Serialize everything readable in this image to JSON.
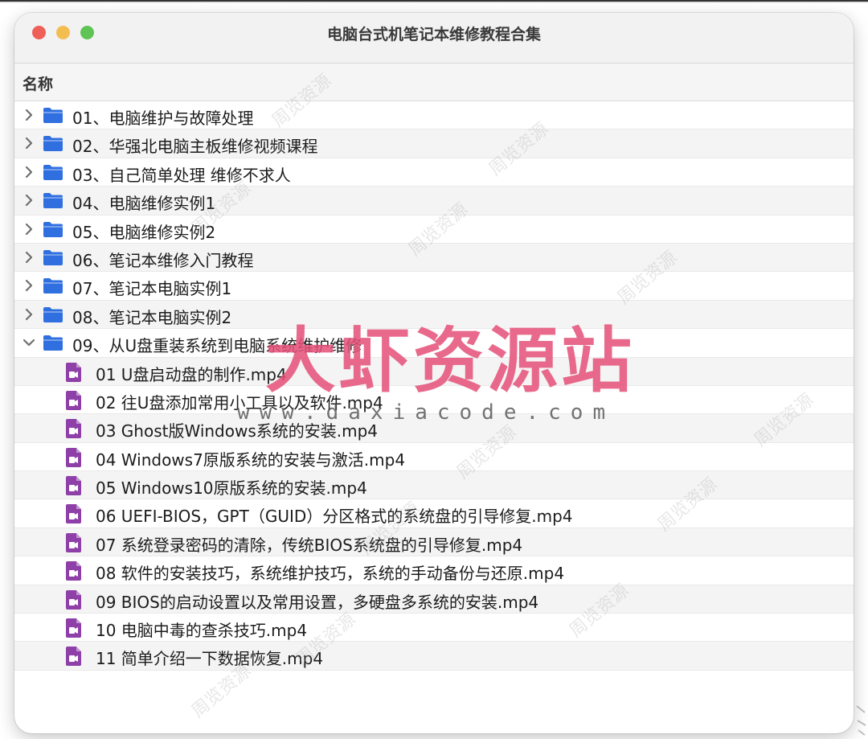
{
  "window": {
    "title": "电脑台式机笔记本维修教程合集"
  },
  "column_header": {
    "name": "名称"
  },
  "folders": [
    {
      "label": "01、电脑维护与故障处理",
      "expanded": false
    },
    {
      "label": "02、华强北电脑主板维修视频课程",
      "expanded": false
    },
    {
      "label": "03、自己简单处理 维修不求人",
      "expanded": false
    },
    {
      "label": "04、电脑维修实例1",
      "expanded": false
    },
    {
      "label": "05、电脑维修实例2",
      "expanded": false
    },
    {
      "label": "06、笔记本维修入门教程",
      "expanded": false
    },
    {
      "label": "07、笔记本电脑实例1",
      "expanded": false
    },
    {
      "label": "08、笔记本电脑实例2",
      "expanded": false
    },
    {
      "label": "09、从U盘重装系统到电脑系统维护维修",
      "expanded": true
    }
  ],
  "files": [
    "01 U盘启动盘的制作.mp4",
    "02 往U盘添加常用小工具以及软件.mp4",
    "03 Ghost版Windows系统的安装.mp4",
    "04 Windows7原版系统的安装与激活.mp4",
    "05 Windows10原版系统的安装.mp4",
    "06 UEFI-BIOS，GPT（GUID）分区格式的系统盘的引导修复.mp4",
    "07 系统登录密码的清除，传统BIOS系统盘的引导修复.mp4",
    "08 软件的安装技巧，系统维护技巧，系统的手动备份与还原.mp4",
    "09 BIOS的启动设置以及常用设置，多硬盘多系统的安装.mp4",
    "10 电脑中毒的查杀技巧.mp4",
    "11 简单介绍一下数据恢复.mp4"
  ],
  "watermark": {
    "brand": "大虾资源站",
    "url": "www.daxiacode.com",
    "faint": "周览资源"
  },
  "icons": {
    "folder": "folder-icon",
    "file": "video-file-icon",
    "collapsed": "chevron-right-icon",
    "expanded": "chevron-down-icon"
  },
  "colors": {
    "folder": "#2f6fe0",
    "file": "#8e3fa8",
    "close": "#ee5f57",
    "minimize": "#f4bd4f",
    "maximize": "#5fc454",
    "watermark": "#e45078"
  }
}
